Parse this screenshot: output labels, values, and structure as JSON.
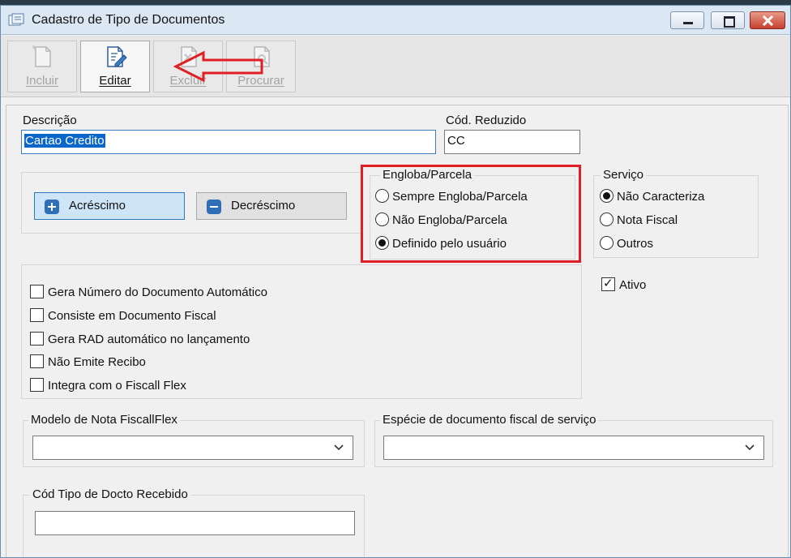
{
  "window": {
    "title": "Cadastro de Tipo de Documentos"
  },
  "toolbar": {
    "buttons": [
      {
        "label": "Incluir",
        "enabled": false
      },
      {
        "label": "Editar",
        "enabled": true
      },
      {
        "label": "Excluir",
        "enabled": false
      },
      {
        "label": "Procurar",
        "enabled": false
      }
    ]
  },
  "form": {
    "descricao_label": "Descrição",
    "descricao_value": "Cartao Credito",
    "cod_reduzido_label": "Cód. Reduzido",
    "cod_reduzido_value": "CC",
    "acrescimo_label": "Acréscimo",
    "decrescimo_label": "Decréscimo",
    "engloba": {
      "title": "Engloba/Parcela",
      "options": [
        "Sempre Engloba/Parcela",
        "Não Engloba/Parcela",
        "Definido pelo usuário"
      ],
      "selected": "Definido pelo usuário"
    },
    "servico": {
      "title": "Serviço",
      "options": [
        "Não Caracteriza",
        "Nota Fiscal",
        "Outros"
      ],
      "selected": "Não Caracteriza"
    },
    "ativo_label": "Ativo",
    "ativo_checked": true,
    "checkboxes": [
      {
        "label": "Gera Número do Documento Automático",
        "checked": false
      },
      {
        "label": "Consiste em Documento Fiscal",
        "checked": false
      },
      {
        "label": "Gera RAD automático no lançamento",
        "checked": false
      },
      {
        "label": "Não Emite Recibo",
        "checked": false
      },
      {
        "label": "Integra com o Fiscall Flex",
        "checked": false
      }
    ],
    "modelo_label": "Modelo de Nota FiscallFlex",
    "modelo_value": "",
    "especie_label": "Espécie de documento fiscal de serviço",
    "especie_value": "",
    "cod_tipo_label": "Cód Tipo de Docto Recebido",
    "cod_tipo_value": ""
  },
  "colors": {
    "highlight": "#e01e24",
    "accent": "#2e6fb8",
    "selection": "#0a66c8"
  }
}
